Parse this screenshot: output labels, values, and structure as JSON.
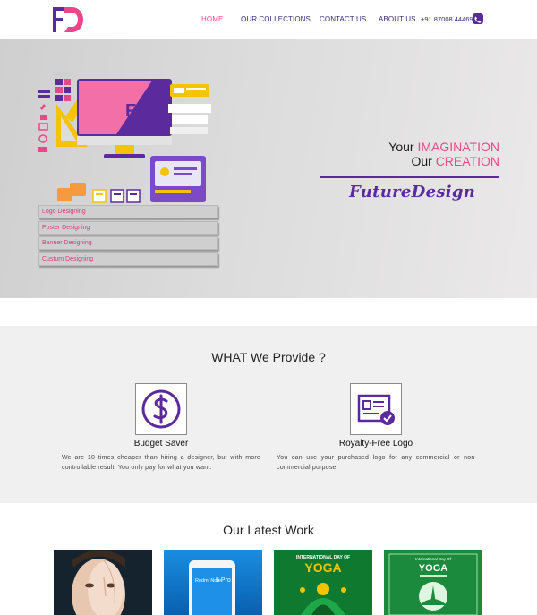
{
  "nav": {
    "logo_text": "FD",
    "links": [
      "HOME",
      "OUR COLLECTIONS",
      "CONTACT US",
      "ABOUT US"
    ],
    "phone": "+91 87008 44469",
    "phone_icon": "phone-icon"
  },
  "hero": {
    "services": [
      "Logo Designing",
      "Poster Designing",
      "Banner Designing",
      "Custum Designing"
    ],
    "tagline_line1_prefix": "Your ",
    "tagline_line1_highlight": "IMAGINATION",
    "tagline_line2_prefix": "Our ",
    "tagline_line2_highlight": "CREATION",
    "brand_script": "FutureDesign",
    "illustration_monogram": "FD"
  },
  "provide": {
    "title": "WHAT We Provide ?",
    "features": [
      {
        "icon": "dollar-icon",
        "title": "Budget Saver",
        "desc": "We are 10 times cheaper than hiring a designer, but with more controllable result. You only pay for what you want."
      },
      {
        "icon": "certificate-icon",
        "title": "Royalty-Free Logo",
        "desc": "You can use your purchased logo for any commercial or non-commercial purpose."
      }
    ]
  },
  "work": {
    "title": "Our Latest Work",
    "items": [
      {
        "kind": "face-portrait"
      },
      {
        "kind": "phone-ad",
        "text_a": "Redmi Note",
        "text_b": "5 Pro"
      },
      {
        "kind": "yoga-poster-dark",
        "text_small": "INTERNATIONAL DAY OF",
        "text_big": "YOGA"
      },
      {
        "kind": "yoga-poster-light",
        "text_small": "International Day Of",
        "text_big": "YOGA"
      }
    ]
  },
  "colors": {
    "brand_purple": "#5b2b9e",
    "brand_pink": "#e8488a",
    "nav_text": "#3a2a7a"
  }
}
